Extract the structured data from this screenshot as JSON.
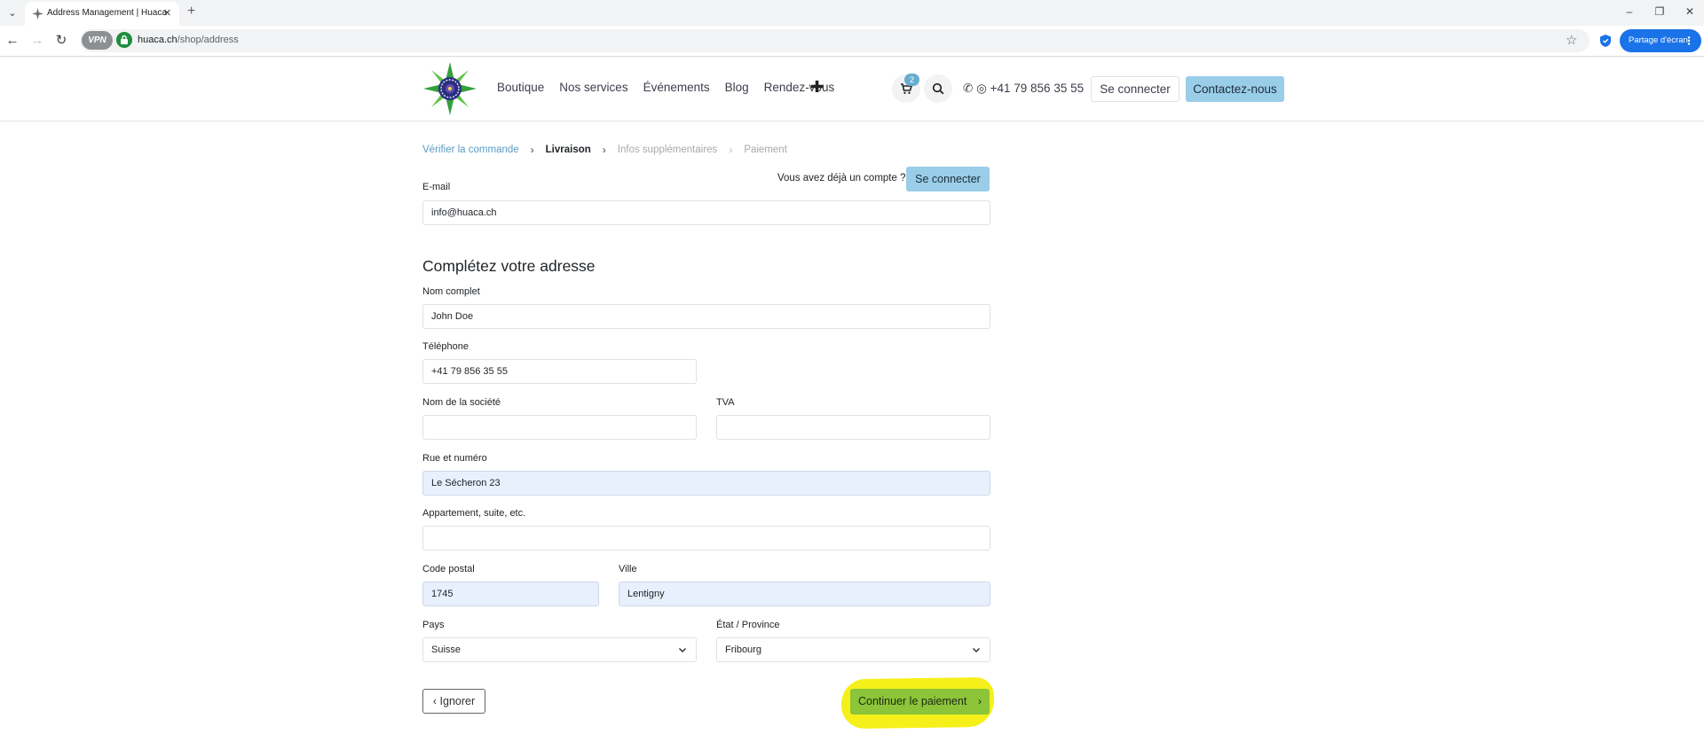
{
  "browser": {
    "tab_title": "Address Management | Huaca",
    "url_host": "huaca.ch",
    "url_path": "/shop/address",
    "vpn_label": "VPN",
    "share_label": "Partage d'écran",
    "icons": [
      "tab-search-icon",
      "favicon-icon",
      "close-tab-icon",
      "new-tab-icon",
      "minimize-icon",
      "restore-icon",
      "back-icon",
      "forward-icon",
      "reload-icon",
      "lock-icon",
      "bookmark-star-icon",
      "shield-icon",
      "more-icon"
    ]
  },
  "header": {
    "nav": [
      "Boutique",
      "Nos services",
      "Événements",
      "Blog",
      "Rendez-vous"
    ],
    "cart_count": "2",
    "phone": "+41 79 856 35 55",
    "login_label": "Se connecter",
    "contact_label": "Contactez-nous",
    "colors": {
      "accent": "#99cde8",
      "badge": "#66aecf"
    }
  },
  "checkout": {
    "steps": [
      {
        "label": "Vérifier la commande",
        "state": "done"
      },
      {
        "label": "Livraison",
        "state": "current"
      },
      {
        "label": "Infos supplémentaires",
        "state": "todo"
      },
      {
        "label": "Paiement",
        "state": "todo"
      }
    ],
    "already_account": "Vous avez déjà un compte ?",
    "signin_label": "Se connecter",
    "email_label": "E-mail",
    "email_value": "info@huaca.ch",
    "section_title": "Complétez votre adresse",
    "fields": {
      "name_label": "Nom complet",
      "name_value": "John Doe",
      "phone_label": "Téléphone",
      "phone_value": "+41 79 856 35 55",
      "company_label": "Nom de la société",
      "company_value": "",
      "vat_label": "TVA",
      "vat_value": "",
      "street_label": "Rue et numéro",
      "street_value": "Le Sécheron 23",
      "apt_label": "Appartement, suite, etc.",
      "apt_value": "",
      "zip_label": "Code postal",
      "zip_value": "1745",
      "city_label": "Ville",
      "city_value": "Lentigny",
      "country_label": "Pays",
      "country_value": "Suisse",
      "state_label": "État / Province",
      "state_value": "Fribourg"
    },
    "ignore_label": "Ignorer",
    "continue_label": "Continuer le paiement",
    "colors": {
      "continue": "#8cc43a",
      "highlight": "#f5f019",
      "autofill": "#e8f0fe",
      "link": "#5a9bc2"
    }
  }
}
